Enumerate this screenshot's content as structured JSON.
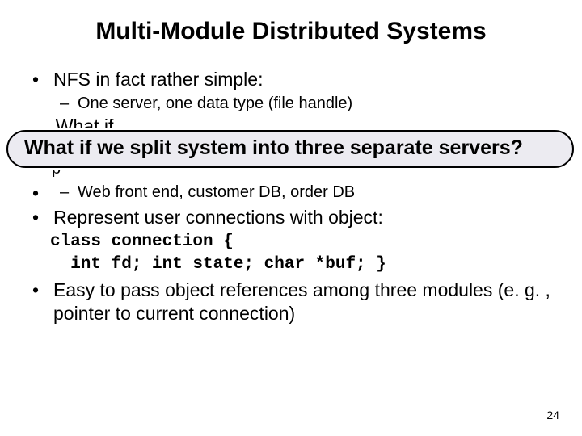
{
  "title": "Multi-Module Distributed Systems",
  "bullet1": "NFS in fact rather simple:",
  "sub1a": "One server, one data type (file handle)",
  "cutTopPartial": ". What if",
  "callout": "What if we split system into three separate servers?",
  "cutBottomPartial": "p",
  "sub2a": "Web front end,  customer DB, order DB",
  "bullet3": "Represent user connections with object:",
  "codeLine1": "class connection {",
  "codeLine2": "  int fd; int state; char *buf; }",
  "bullet4": "Easy to pass object references among three modules (e. g. , pointer to current connection)",
  "pagenum": "24"
}
